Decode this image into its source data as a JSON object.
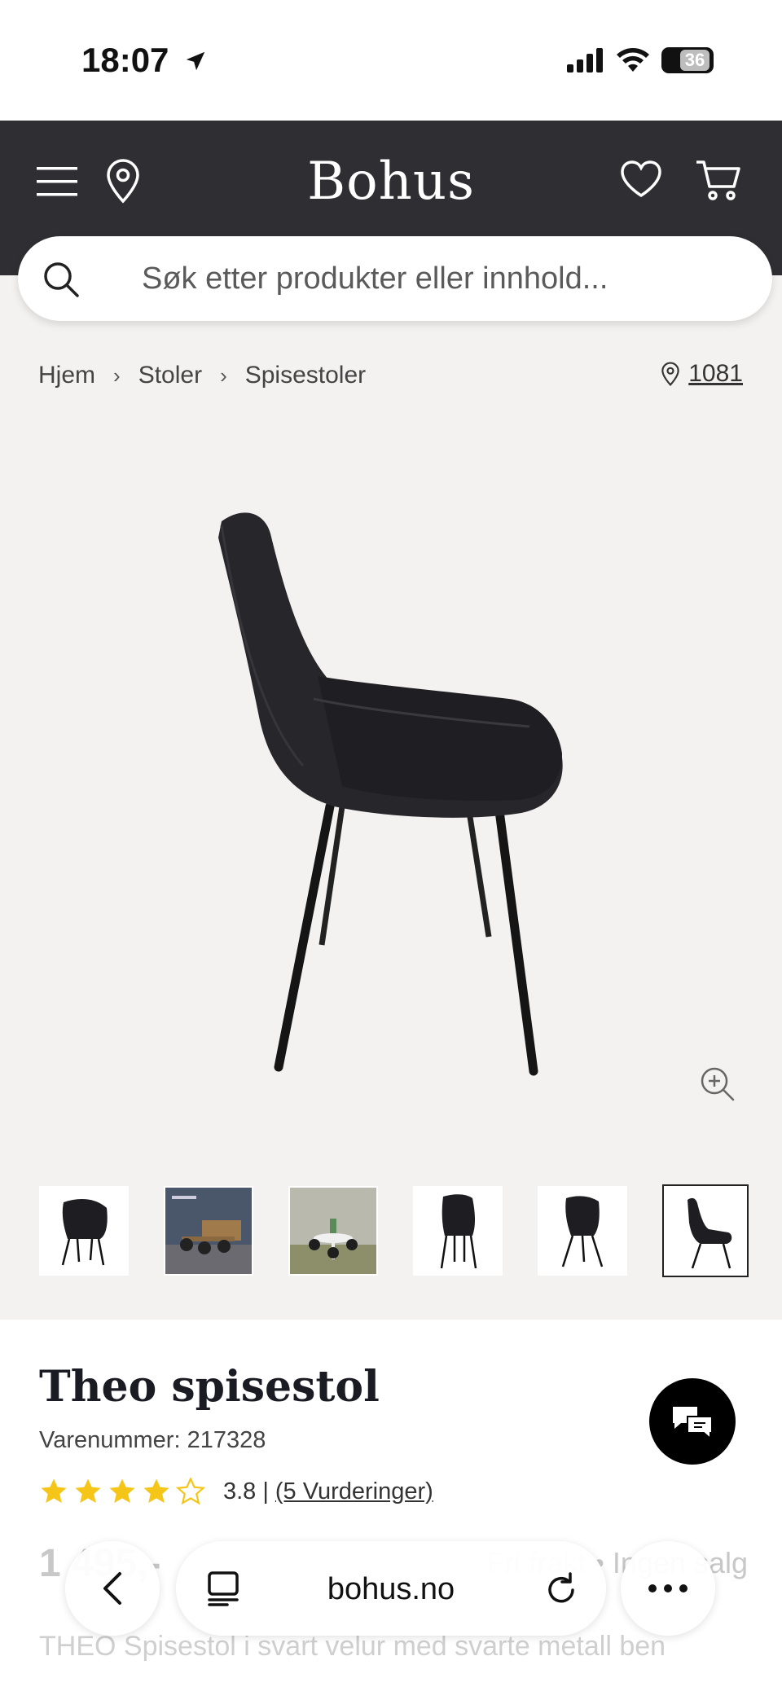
{
  "status_bar": {
    "time": "18:07",
    "battery": "36"
  },
  "header": {
    "logo": "Bohus"
  },
  "search": {
    "placeholder": "Søk etter produkter eller innhold..."
  },
  "breadcrumb": {
    "items": [
      "Hjem",
      "Stoler",
      "Spisestoler"
    ]
  },
  "store": {
    "label": "1081"
  },
  "product": {
    "title": "Theo spisestol",
    "sku": "Varenummer: 217328",
    "rating_value": "3.8",
    "rating_sep": "|",
    "reviews_link": "(5 Vurderinger)",
    "stars": 3.8,
    "description": "THEO Spisestol i svart velur med svarte metall ben",
    "faded_left": "1 495,-",
    "faded_right": "Fri frakt • Ingen salg"
  },
  "browser": {
    "url": "bohus.no"
  },
  "colors": {
    "header_bg": "#2f2f33",
    "page_bg": "#f4f2f0",
    "star": "#f5c518"
  }
}
